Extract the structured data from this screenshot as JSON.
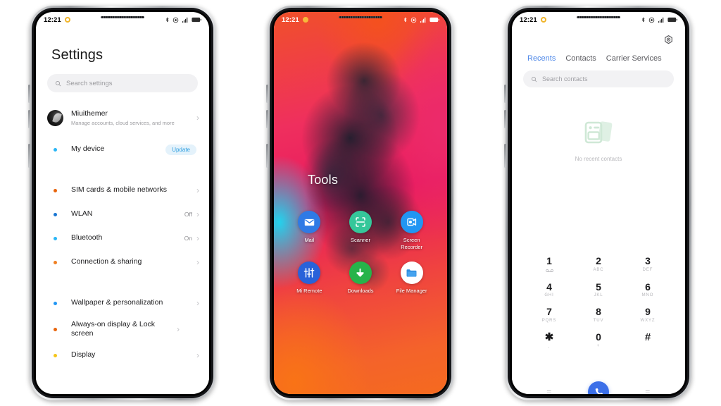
{
  "statusbar": {
    "time": "12:21",
    "icons": [
      "bluetooth-icon",
      "dnd-icon",
      "signal-icon",
      "battery-icon"
    ]
  },
  "phone1": {
    "title": "Settings",
    "search": {
      "placeholder": "Search settings",
      "icon": "search-icon"
    },
    "account": {
      "name": "Miuithemer",
      "subtitle": "Manage accounts, cloud services, and more",
      "chevron": "›"
    },
    "device": {
      "label": "My device",
      "badge": "Update",
      "bullet_color": "#29b6f6"
    },
    "group1": [
      {
        "label": "SIM cards & mobile networks",
        "value": "",
        "bullet_color": "#e8640c",
        "chevron": "›"
      },
      {
        "label": "WLAN",
        "value": "Off",
        "bullet_color": "#1976d2",
        "chevron": "›"
      },
      {
        "label": "Bluetooth",
        "value": "On",
        "bullet_color": "#29b6f6",
        "chevron": "›"
      },
      {
        "label": "Connection & sharing",
        "value": "",
        "bullet_color": "#ef8023",
        "chevron": "›"
      }
    ],
    "group2": [
      {
        "label": "Wallpaper & personalization",
        "value": "",
        "bullet_color": "#2196f3",
        "chevron": "›"
      },
      {
        "label": "Always-on display & Lock screen",
        "value": "",
        "bullet_color": "#e8640c",
        "chevron": "›"
      },
      {
        "label": "Display",
        "value": "",
        "bullet_color": "#f5c518",
        "chevron": "›"
      }
    ]
  },
  "phone2": {
    "folder_title": "Tools",
    "apps": [
      {
        "name": "Mail",
        "icon": "mail-icon",
        "color": "#2f7ae5"
      },
      {
        "name": "Scanner",
        "icon": "scanner-icon",
        "color": "#35c79a"
      },
      {
        "name": "Screen Recorder",
        "icon": "screen-recorder-icon",
        "color": "#2196f3"
      },
      {
        "name": "Mi Remote",
        "icon": "mi-remote-icon",
        "color": "#2962d9"
      },
      {
        "name": "Downloads",
        "icon": "downloads-icon",
        "color": "#27b34a"
      },
      {
        "name": "File Manager",
        "icon": "file-manager-icon",
        "color": "#ffffff"
      }
    ]
  },
  "phone3": {
    "settings_icon": "gear-icon",
    "tabs": [
      {
        "label": "Recents",
        "active": true
      },
      {
        "label": "Contacts",
        "active": false
      },
      {
        "label": "Carrier Services",
        "active": false
      }
    ],
    "search": {
      "placeholder": "Search contacts",
      "icon": "search-icon"
    },
    "empty_state": {
      "icon": "contact-cards-icon",
      "text": "No recent contacts"
    },
    "keypad": [
      {
        "digit": "1",
        "sub": "",
        "voicemail": true
      },
      {
        "digit": "2",
        "sub": "ABC",
        "voicemail": false
      },
      {
        "digit": "3",
        "sub": "DEF",
        "voicemail": false
      },
      {
        "digit": "4",
        "sub": "GHI",
        "voicemail": false
      },
      {
        "digit": "5",
        "sub": "JKL",
        "voicemail": false
      },
      {
        "digit": "6",
        "sub": "MNO",
        "voicemail": false
      },
      {
        "digit": "7",
        "sub": "PQRS",
        "voicemail": false
      },
      {
        "digit": "8",
        "sub": "TUV",
        "voicemail": false
      },
      {
        "digit": "9",
        "sub": "WXYZ",
        "voicemail": false
      },
      {
        "digit": "✱",
        "sub": ",",
        "voicemail": false
      },
      {
        "digit": "0",
        "sub": "+",
        "voicemail": false
      },
      {
        "digit": "#",
        "sub": "",
        "voicemail": false
      }
    ],
    "bottom": {
      "left_label": "=",
      "right_label": "=",
      "call_icon": "phone-call-icon",
      "call_color": "#3b6fe8"
    }
  }
}
